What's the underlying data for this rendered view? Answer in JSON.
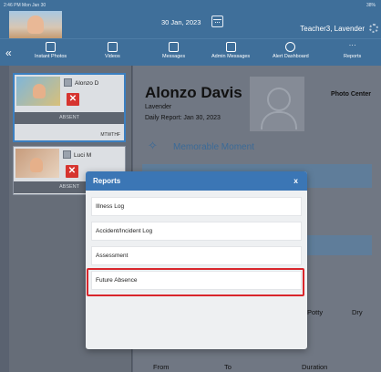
{
  "status": {
    "time": "2:46 PM  Mon Jan 30",
    "battery": "38%"
  },
  "header": {
    "date": "30 Jan, 2023",
    "user": "Teacher3, Lavender"
  },
  "toolbar": {
    "collapse": "«",
    "items": [
      {
        "label": "Instant Photos",
        "icon": "photo-grid-icon"
      },
      {
        "label": "Videos",
        "icon": "play-icon"
      },
      {
        "label": "Messages",
        "icon": "message-icon"
      },
      {
        "label": "Admin Messages",
        "icon": "admin-message-icon"
      },
      {
        "label": "Alert Dashboard",
        "icon": "alarm-clock-icon"
      },
      {
        "label": "Reports",
        "icon": "more-dots-icon"
      }
    ]
  },
  "children": [
    {
      "name": "Alonzo D",
      "status": "ABSENT",
      "schedule": "MTWTHF"
    },
    {
      "name": "Luci M",
      "status": "ABSENT"
    }
  ],
  "profile": {
    "name": "Alonzo Davis",
    "classroom": "Lavender",
    "report_date": "Daily Report: Jan 30, 2023",
    "photo_center": "Photo Center",
    "section_title": "Memorable Moment"
  },
  "table_labels": {
    "potty": "Potty",
    "dry": "Dry",
    "from": "From",
    "to": "To",
    "duration": "Duration"
  },
  "modal": {
    "title": "Reports",
    "close": "x",
    "items": [
      "Illness Log",
      "Accident/Incident Log",
      "Assessment",
      "Future Absence"
    ],
    "highlighted_item": "Future Absence"
  },
  "colors": {
    "header_blue": "#3f6f9a",
    "modal_head": "#3b76b5",
    "highlight_red": "#d9262c",
    "absent_x": "#d6342f"
  }
}
